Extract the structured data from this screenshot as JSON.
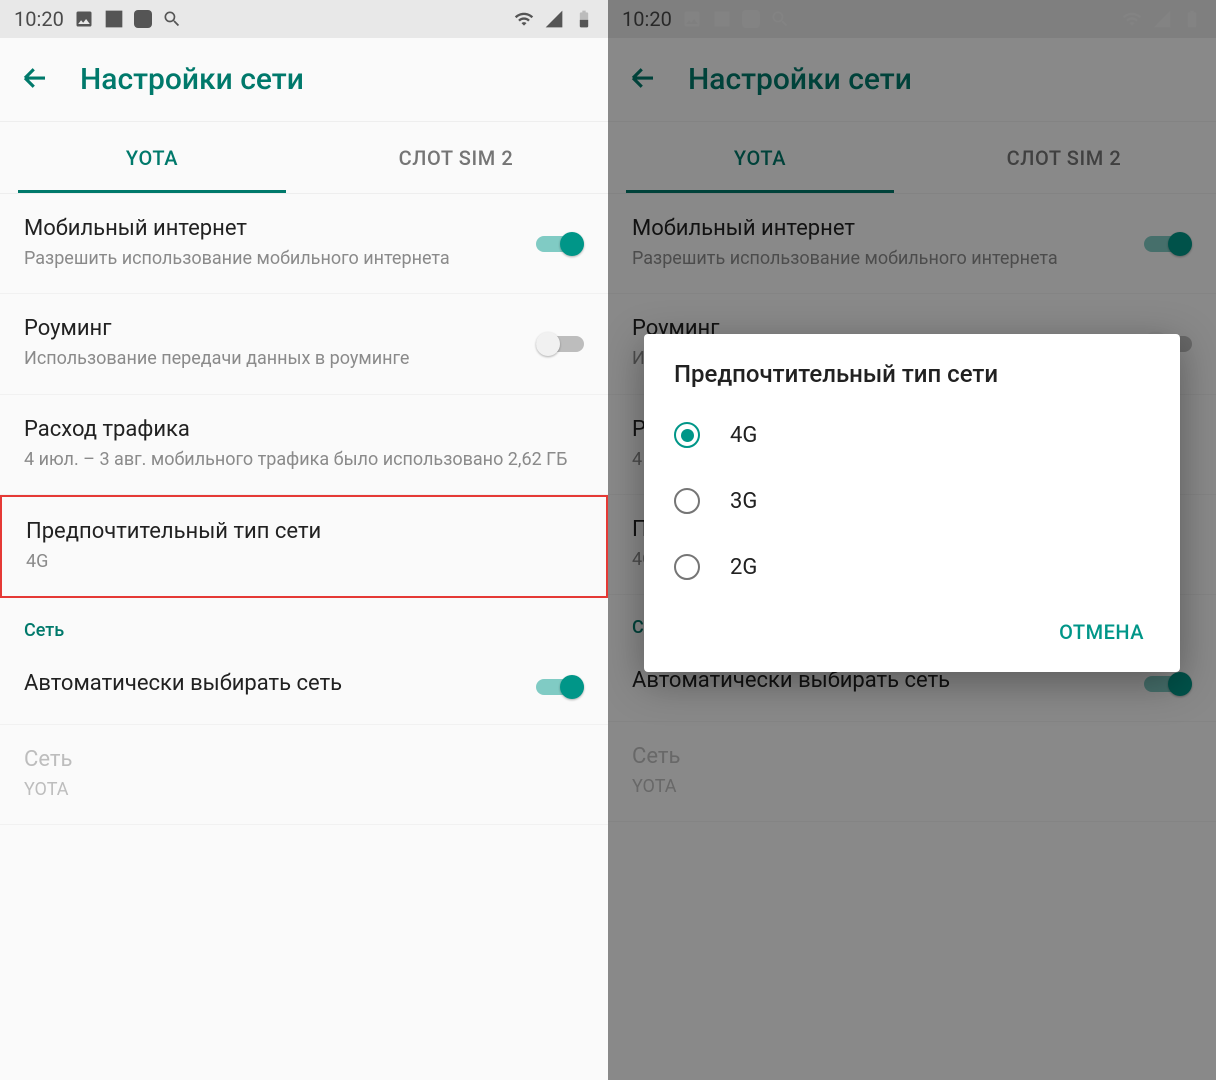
{
  "statusbar": {
    "time": "10:20"
  },
  "appbar": {
    "title": "Настройки сети"
  },
  "tabs": {
    "active": "YOTA",
    "inactive": "СЛОТ SIM 2"
  },
  "items": {
    "mobile_data": {
      "title": "Мобильный интернет",
      "sub": "Разрешить использование мобильного интернета"
    },
    "roaming": {
      "title": "Роуминг",
      "sub": "Использование передачи данных в роуминге"
    },
    "usage": {
      "title": "Расход трафика",
      "sub": "4 июл. – 3 авг. мобильного трафика было использовано 2,62 ГБ"
    },
    "pref_net": {
      "title": "Предпочтительный тип сети",
      "sub": "4G"
    },
    "section_net": "Сеть",
    "auto_net": {
      "title": "Автоматически выбирать сеть"
    },
    "net_manual": {
      "title": "Сеть",
      "sub": "YOTA"
    }
  },
  "dialog": {
    "title": "Предпочтительный тип сети",
    "opt1": "4G",
    "opt2": "3G",
    "opt3": "2G",
    "cancel": "ОТМЕНА"
  }
}
